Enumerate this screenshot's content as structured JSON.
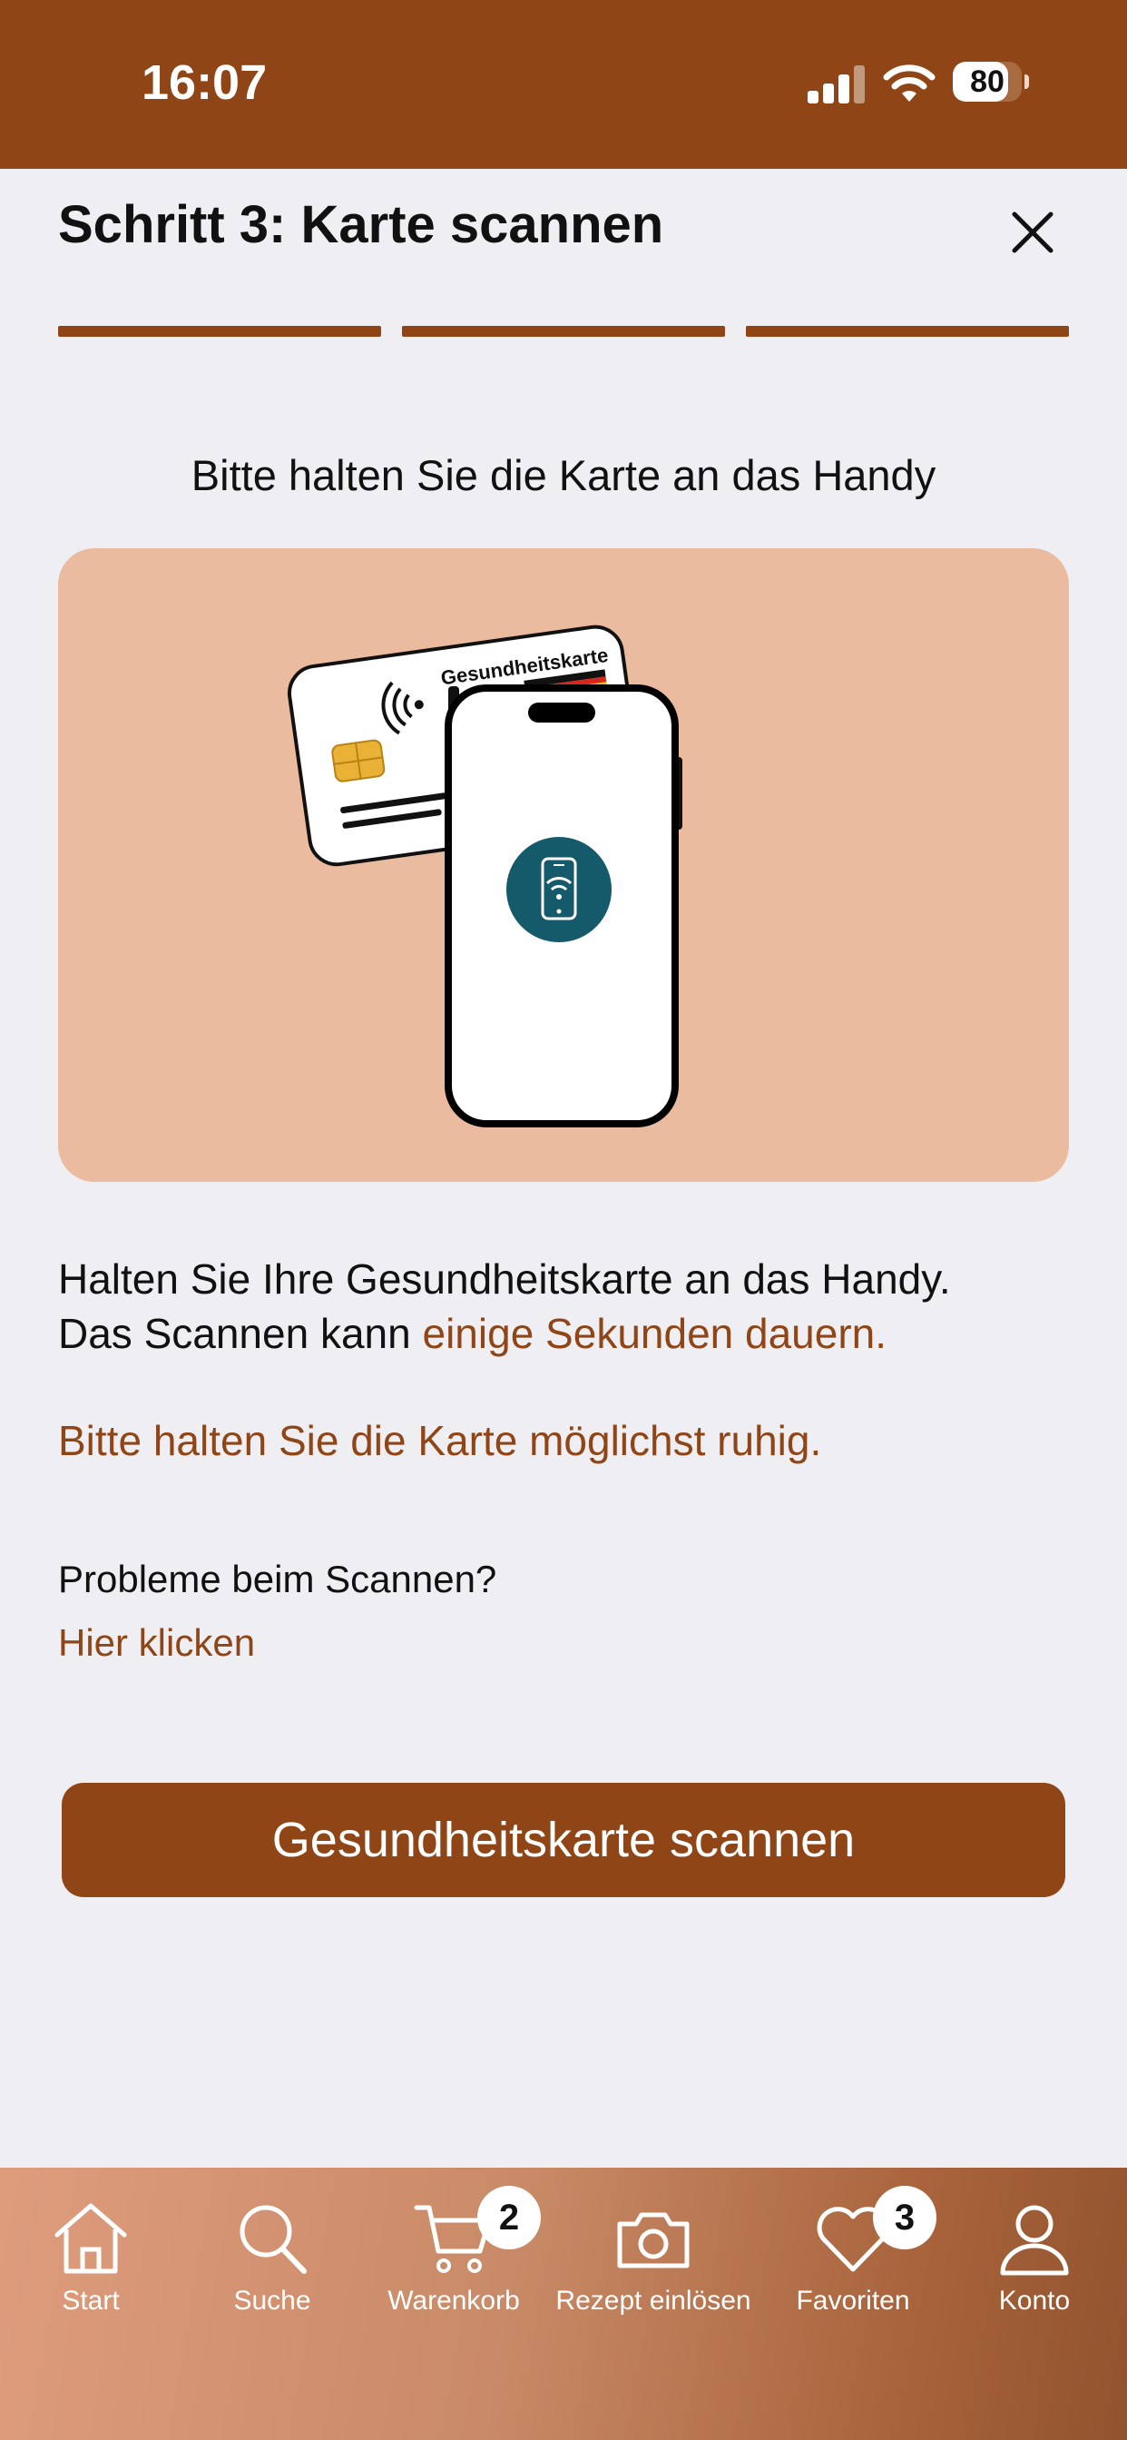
{
  "status_bar": {
    "time": "16:07",
    "battery": "80",
    "battery_level": 0.8
  },
  "header": {
    "title": "Schritt 3: Karte scannen",
    "progress_steps": 3,
    "progress_done": 3
  },
  "instruction": {
    "heading": "Bitte halten Sie die Karte an das Handy"
  },
  "illustration": {
    "card_label": "Gesundheitskarte"
  },
  "description": {
    "line1": "Halten Sie Ihre Gesundheitskarte an das Handy.",
    "line2_prefix": "Das Scannen kann ",
    "line2_accent": "einige Sekunden dauern.",
    "hold_note": "Bitte halten Sie die Karte möglichst ruhig."
  },
  "help": {
    "label": "Probleme beim Scannen?",
    "link": "Hier klicken"
  },
  "scan_button": {
    "label": "Gesundheitskarte scannen"
  },
  "tabbar": {
    "items": [
      {
        "label": "Start",
        "icon": "home-icon"
      },
      {
        "label": "Suche",
        "icon": "search-icon"
      },
      {
        "label": "Warenkorb",
        "icon": "cart-icon",
        "badge": "2"
      },
      {
        "label": "Rezept einlösen",
        "icon": "camera-icon"
      },
      {
        "label": "Favoriten",
        "icon": "heart-icon",
        "badge": "3"
      },
      {
        "label": "Konto",
        "icon": "user-icon"
      }
    ]
  },
  "colors": {
    "accent": "#8f4516",
    "background": "#efeff3",
    "illustration_bg": "#eabb9f",
    "nfc_circle": "#155a6a"
  }
}
